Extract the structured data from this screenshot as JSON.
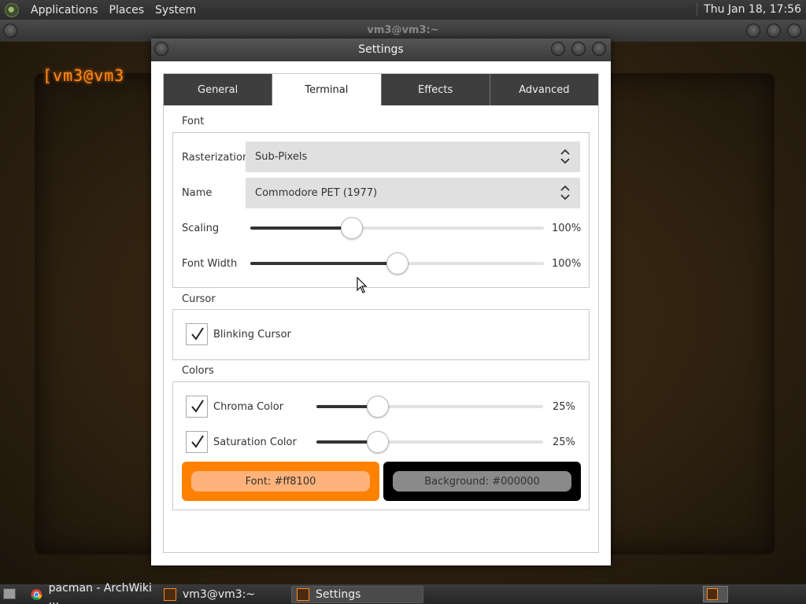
{
  "top_panel": {
    "menus": [
      "Applications",
      "Places",
      "System"
    ],
    "clock": "Thu Jan 18, 17:56"
  },
  "background_window": {
    "title": "vm3@vm3:~",
    "prompt": "[vm3@vm3"
  },
  "dialog": {
    "title": "Settings",
    "tabs": [
      {
        "label": "General",
        "active": false
      },
      {
        "label": "Terminal",
        "active": true
      },
      {
        "label": "Effects",
        "active": false
      },
      {
        "label": "Advanced",
        "active": false
      }
    ],
    "font_section": {
      "title": "Font",
      "rasterization": {
        "label": "Rasterization",
        "value": "Sub-Pixels"
      },
      "name": {
        "label": "Name",
        "value": "Commodore PET (1977)"
      },
      "scaling": {
        "label": "Scaling",
        "value_text": "100%",
        "position": 0.345
      },
      "font_width": {
        "label": "Font Width",
        "value_text": "100%",
        "position": 0.5
      }
    },
    "cursor_section": {
      "title": "Cursor",
      "blinking": {
        "label": "Blinking Cursor",
        "checked": true
      }
    },
    "colors_section": {
      "title": "Colors",
      "chroma": {
        "label": "Chroma Color",
        "checked": true,
        "value_text": "25%",
        "position": 0.27
      },
      "saturation": {
        "label": "Saturation Color",
        "checked": true,
        "value_text": "25%",
        "position": 0.27
      },
      "font_color": {
        "label": "Font:  #ff8100",
        "color": "#ff8100"
      },
      "background_color": {
        "label": "Background:  #000000",
        "color": "#000000"
      }
    }
  },
  "taskbar": {
    "items": [
      {
        "label": "pacman - ArchWiki ..."
      },
      {
        "label": "vm3@vm3:~"
      },
      {
        "label": "Settings",
        "active": true
      }
    ]
  }
}
